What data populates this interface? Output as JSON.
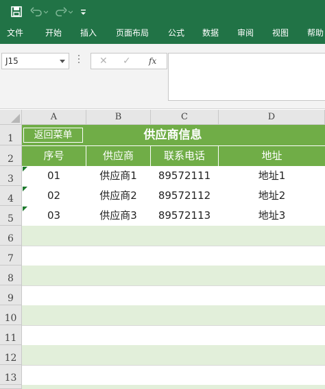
{
  "window": {
    "accent": "#217346",
    "band_green": "#70ad47",
    "band_light": "#e2efda"
  },
  "quick_access": {
    "icons": [
      "save-icon",
      "undo-icon",
      "redo-icon",
      "customize-icon"
    ]
  },
  "ribbon": {
    "tabs": [
      "文件",
      "开始",
      "插入",
      "页面布局",
      "公式",
      "数据",
      "审阅",
      "视图",
      "帮助"
    ]
  },
  "formula_bar": {
    "name_box": "J15",
    "cancel_glyph": "✕",
    "enter_glyph": "✓",
    "fx_label": "fx",
    "value": ""
  },
  "sheet": {
    "columns": [
      "A",
      "B",
      "C",
      "D"
    ],
    "rows": [
      "1",
      "2",
      "3",
      "4",
      "5",
      "6",
      "7",
      "8",
      "9",
      "10",
      "11",
      "12",
      "13"
    ],
    "menu_button": "返回菜单",
    "title": "供应商信息",
    "headers": [
      "序号",
      "供应商",
      "联系电话",
      "地址"
    ],
    "data": [
      [
        "01",
        "供应商1",
        "89572111",
        "地址1"
      ],
      [
        "02",
        "供应商2",
        "89572112",
        "地址2"
      ],
      [
        "03",
        "供应商3",
        "89572113",
        "地址3"
      ]
    ]
  }
}
